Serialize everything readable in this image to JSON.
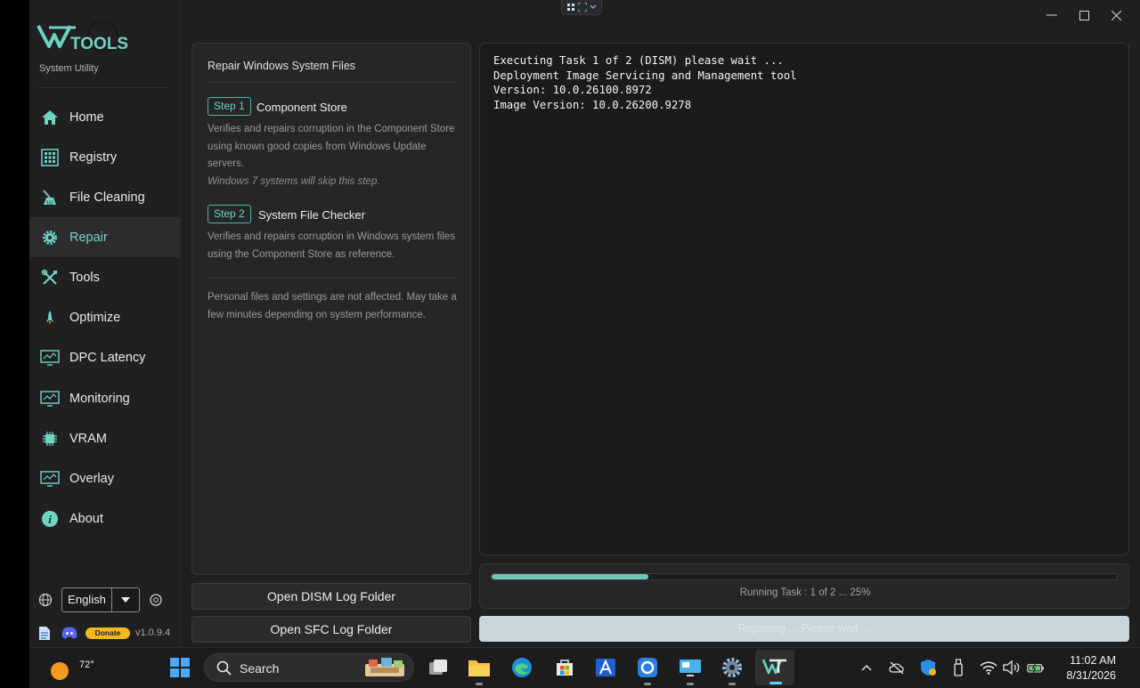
{
  "app": {
    "logo_text": "TOOLS",
    "subtitle": "System Utility",
    "version": "v1.0.9.4",
    "donate_label": "Donate",
    "accent": "#74d4c4"
  },
  "sidebar": {
    "items": [
      {
        "label": "Home",
        "icon": "home-icon",
        "active": false
      },
      {
        "label": "Registry",
        "icon": "registry-icon",
        "active": false
      },
      {
        "label": "File Cleaning",
        "icon": "broom-icon",
        "active": false
      },
      {
        "label": "Repair",
        "icon": "gear-icon",
        "active": true
      },
      {
        "label": "Tools",
        "icon": "tools-icon",
        "active": false
      },
      {
        "label": "Optimize",
        "icon": "rocket-icon",
        "active": false
      },
      {
        "label": "DPC Latency",
        "icon": "monitor-chart-icon",
        "active": false
      },
      {
        "label": "Monitoring",
        "icon": "monitor-chart-icon",
        "active": false
      },
      {
        "label": "VRAM",
        "icon": "chip-icon",
        "active": false
      },
      {
        "label": "Overlay",
        "icon": "monitor-chart-icon",
        "active": false
      },
      {
        "label": "About",
        "icon": "info-icon",
        "active": false
      }
    ],
    "language": "English"
  },
  "info": {
    "title": "Repair Windows System Files",
    "step1": {
      "badge": "Step 1",
      "title": "Component Store",
      "desc": "Verifies and repairs corruption in the Component Store using known good copies from Windows Update servers.",
      "note": "Windows 7 systems will skip this step."
    },
    "step2": {
      "badge": "Step 2",
      "title": "System File Checker",
      "desc": "Verifies and repairs corruption in Windows system files using the Component Store as reference."
    },
    "footer_note": "Personal files and settings are not affected. May take a few minutes depending on system performance."
  },
  "buttons": {
    "open_dism": "Open DISM Log Folder",
    "open_sfc": "Open SFC Log Folder",
    "action": "Repairing ... Please wait ..."
  },
  "console": {
    "lines": [
      "Executing Task 1 of 2 (DISM) please wait ...",
      "Deployment Image Servicing and Management tool",
      "Version: 10.0.26100.8972",
      "Image Version: 10.0.26200.9278"
    ]
  },
  "progress": {
    "percent": 25,
    "text": "Running Task : 1 of 2 ... 25%"
  },
  "taskbar": {
    "weather_temp": "72°",
    "search_label": "Search",
    "time": "11:02 AM",
    "date": "8/31/2026"
  }
}
